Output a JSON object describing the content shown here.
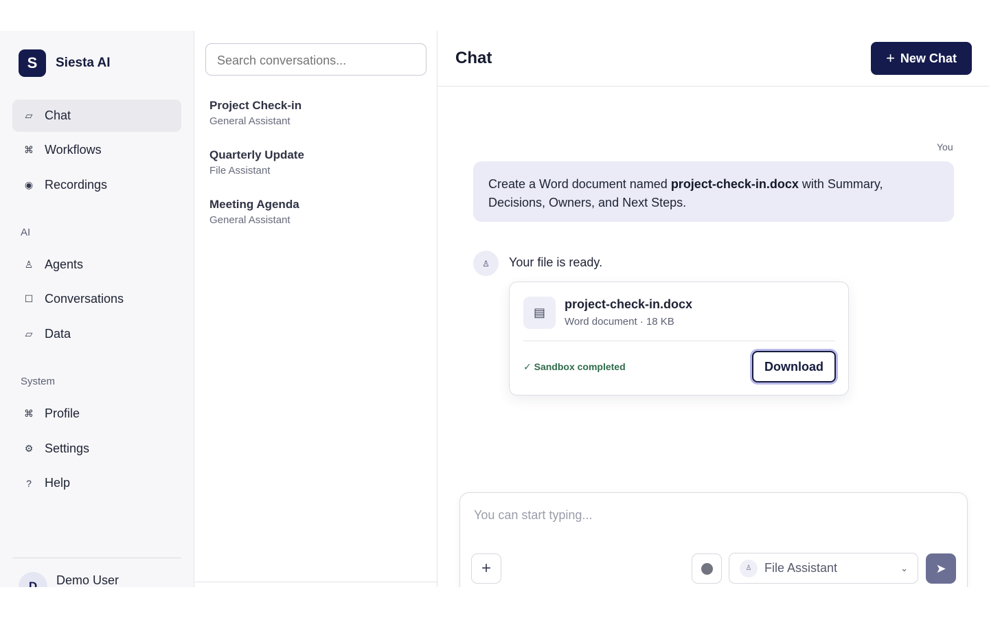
{
  "brand": {
    "logo_letter": "S",
    "name": "Siesta AI"
  },
  "sidebar": {
    "main_items": [
      {
        "label": "Chat",
        "icon": "chat-icon",
        "glyph": "▱",
        "active": true
      },
      {
        "label": "Workflows",
        "icon": "command-icon",
        "glyph": "⌘"
      },
      {
        "label": "Recordings",
        "icon": "record-icon",
        "glyph": "◉"
      }
    ],
    "ai_section": "AI",
    "ai_items": [
      {
        "label": "Agents",
        "icon": "agent-icon",
        "glyph": "♙"
      },
      {
        "label": "Conversations",
        "icon": "square-icon",
        "glyph": "☐"
      },
      {
        "label": "Data",
        "icon": "data-icon",
        "glyph": "▱"
      }
    ],
    "system_section": "System",
    "system_items": [
      {
        "label": "Profile",
        "icon": "command-icon",
        "glyph": "⌘"
      },
      {
        "label": "Settings",
        "icon": "gear-icon",
        "glyph": "⚙"
      },
      {
        "label": "Help",
        "icon": "help-icon",
        "glyph": "?"
      }
    ],
    "user": {
      "initial": "D",
      "name": "Demo User"
    }
  },
  "conversations": {
    "search_placeholder": "Search conversations...",
    "items": [
      {
        "title": "Project Check-in",
        "subtitle": "General Assistant"
      },
      {
        "title": "Quarterly Update",
        "subtitle": "File Assistant"
      },
      {
        "title": "Meeting Agenda",
        "subtitle": "General Assistant"
      }
    ]
  },
  "main": {
    "title": "Chat",
    "new_chat_label": "New Chat",
    "new_chat_icon": "+",
    "you_label": "You",
    "user_message": {
      "before": "Create a Word document named ",
      "bold": "project-check-in.docx",
      "after": " with Summary, Decisions, Owners, and Next Steps."
    },
    "bot_avatar_glyph": "♙",
    "bot_reply": "Your file is ready.",
    "file": {
      "name": "project-check-in.docx",
      "meta": "Word document · 18 KB",
      "icon_glyph": "▤",
      "status": "✓ Sandbox completed",
      "download_label": "Download"
    }
  },
  "composer": {
    "placeholder": "You can start typing...",
    "attach_glyph": "+",
    "agent_glyph": "♙",
    "agent_label": "File Assistant",
    "chevron_glyph": "⌄",
    "send_glyph": "➤"
  },
  "colors": {
    "brand": "#151b4d",
    "active_nav_bg": "#e9e9ee",
    "user_bubble_bg": "#ebebf7",
    "sandbox_green": "#2f6b4a",
    "send_btn": "#6b6f94"
  }
}
